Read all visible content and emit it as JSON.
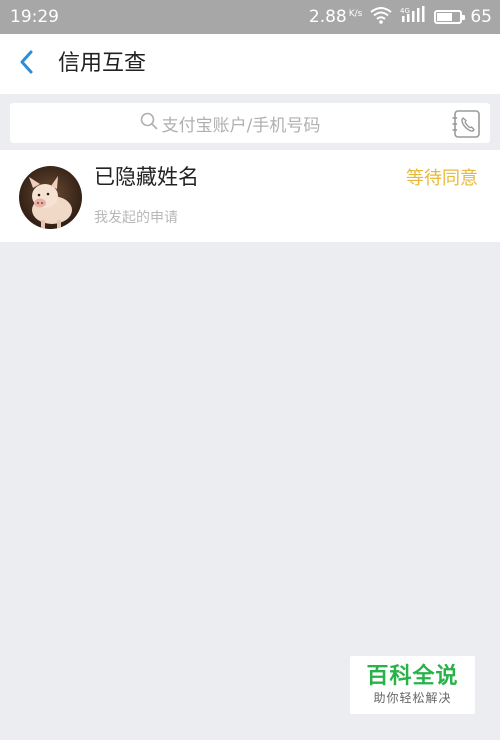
{
  "status_bar": {
    "time": "19:29",
    "net_speed": "2.88",
    "net_unit": "K/s",
    "network_type": "4G",
    "battery": "65",
    "battery_fraction": 0.65
  },
  "nav": {
    "title": "信用互查"
  },
  "search": {
    "placeholder": "支付宝账户/手机号码"
  },
  "list": {
    "items": [
      {
        "name": "已隐藏姓名",
        "subtitle": "我发起的申请",
        "status": "等待同意"
      }
    ]
  },
  "watermark": {
    "title": "百科全说",
    "subtitle": "助你轻松解决"
  },
  "colors": {
    "accent": "#2b8ed8",
    "status_pending": "#e8b83a",
    "background": "#ecedf0",
    "watermark_green": "#2ab24a"
  }
}
